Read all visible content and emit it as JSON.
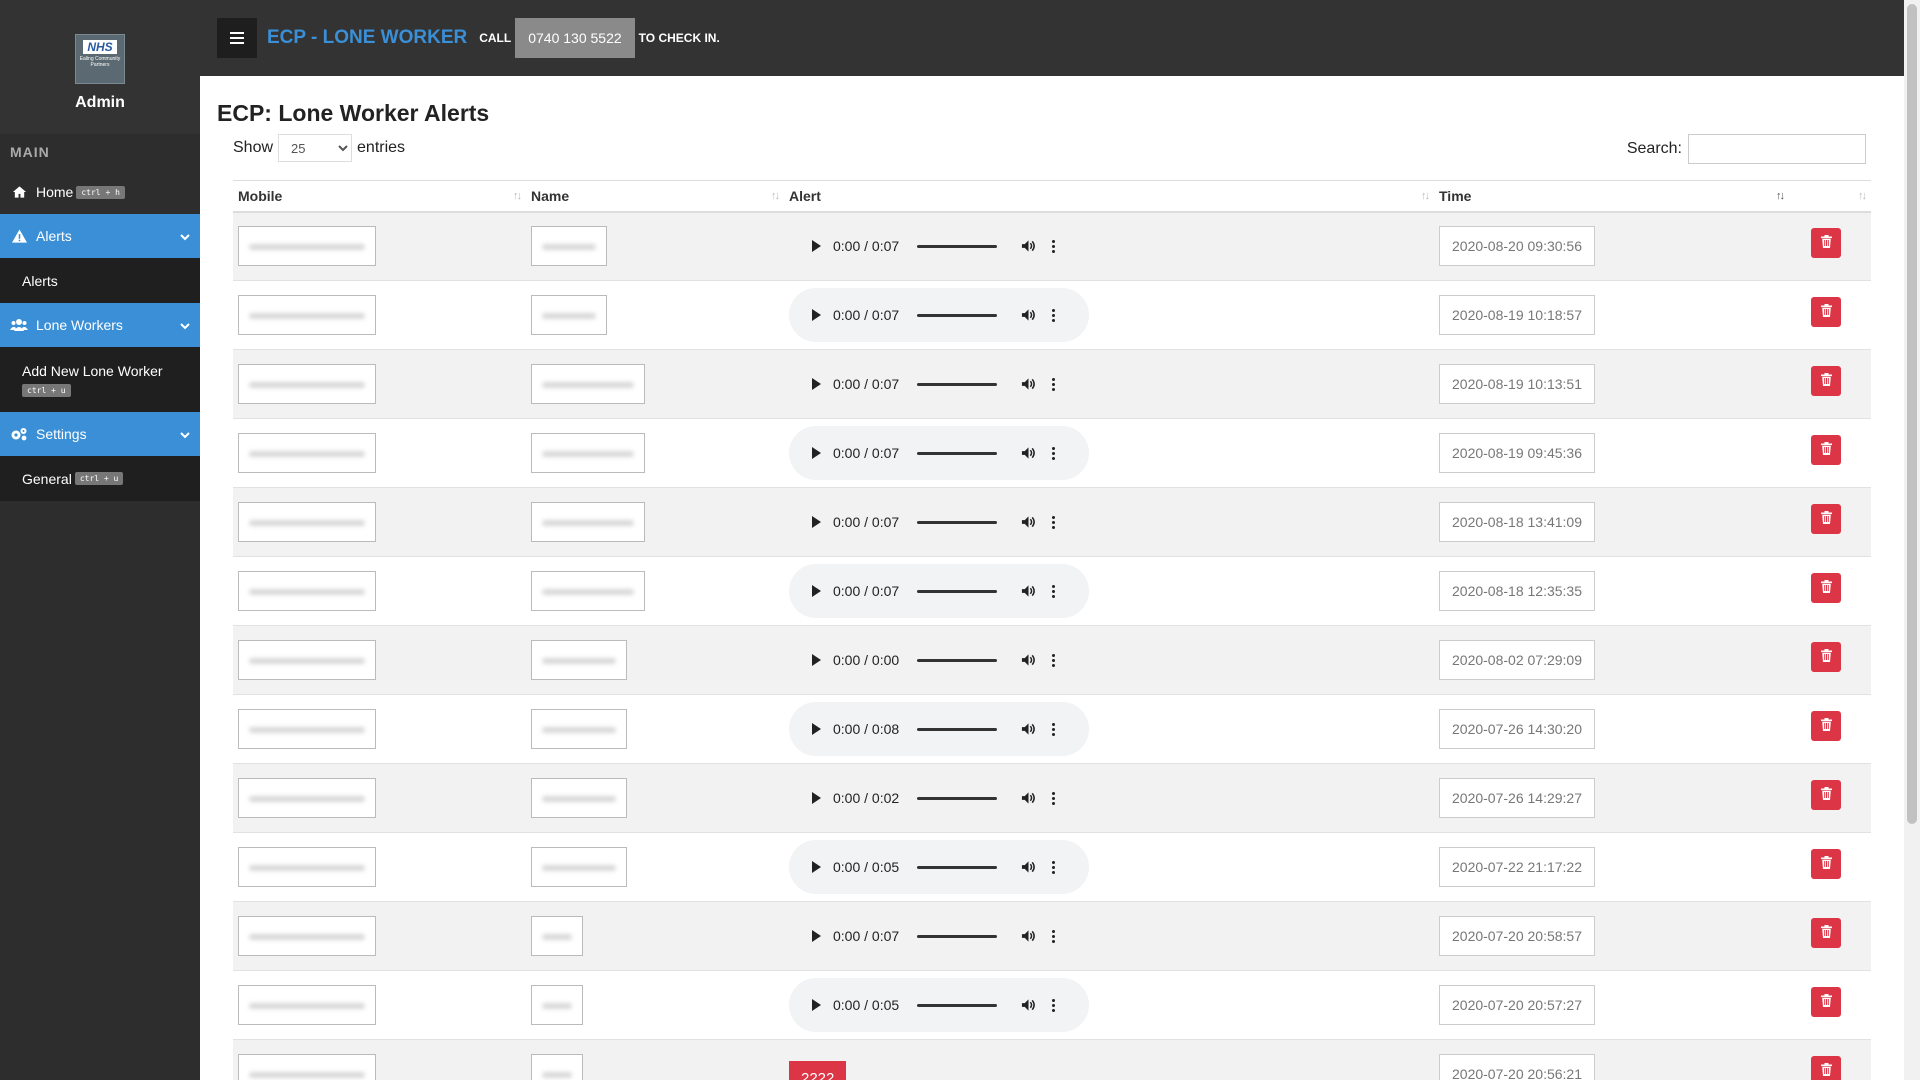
{
  "sidebar": {
    "logo_nhs": "NHS",
    "logo_sub": "Ealing Community Partners",
    "user": "Admin",
    "section": "MAIN",
    "items": {
      "home": {
        "label": "Home",
        "shortcut": "ctrl + h"
      },
      "alerts": {
        "label": "Alerts",
        "sub": "Alerts"
      },
      "lone_workers": {
        "label": "Lone Workers",
        "sub": "Add New Lone Worker",
        "sub_shortcut": "ctrl + u"
      },
      "settings": {
        "label": "Settings",
        "sub": "General",
        "sub_shortcut": "ctrl + u"
      }
    }
  },
  "topbar": {
    "title": "ECP - LONE WORKER",
    "call": "CALL",
    "phone": "0740 130 5522",
    "suffix": "TO CHECK IN."
  },
  "main": {
    "title": "ECP: Lone Worker Alerts",
    "show": "Show",
    "entries_value": "25",
    "entries": "entries",
    "search_label": "Search:",
    "columns": [
      "Mobile",
      "Name",
      "Alert",
      "Time"
    ],
    "rows": [
      {
        "name_w": 76,
        "audio": "0:00 / 0:07",
        "time": "2020-08-20 09:30:56"
      },
      {
        "name_w": 76,
        "audio": "0:00 / 0:07",
        "time": "2020-08-19 10:18:57"
      },
      {
        "name_w": 114,
        "audio": "0:00 / 0:07",
        "time": "2020-08-19 10:13:51"
      },
      {
        "name_w": 114,
        "audio": "0:00 / 0:07",
        "time": "2020-08-19 09:45:36"
      },
      {
        "name_w": 114,
        "audio": "0:00 / 0:07",
        "time": "2020-08-18 13:41:09"
      },
      {
        "name_w": 114,
        "audio": "0:00 / 0:07",
        "time": "2020-08-18 12:35:35"
      },
      {
        "name_w": 96,
        "audio": "0:00 / 0:00",
        "time": "2020-08-02 07:29:09"
      },
      {
        "name_w": 96,
        "audio": "0:00 / 0:08",
        "time": "2020-07-26 14:30:20"
      },
      {
        "name_w": 96,
        "audio": "0:00 / 0:02",
        "time": "2020-07-26 14:29:27"
      },
      {
        "name_w": 96,
        "audio": "0:00 / 0:05",
        "time": "2020-07-22 21:17:22"
      },
      {
        "name_w": 52,
        "audio": "0:00 / 0:07",
        "time": "2020-07-20 20:58:57"
      },
      {
        "name_w": 52,
        "audio": "0:00 / 0:05",
        "time": "2020-07-20 20:57:27"
      },
      {
        "name_w": 52,
        "alert_text": "2222",
        "time": "2020-07-20 20:56:21"
      }
    ]
  },
  "colors": {
    "accent": "#3a8fd6",
    "danger": "#dc3545",
    "sidebar": "#2d2d2d",
    "topbar": "#333333"
  }
}
